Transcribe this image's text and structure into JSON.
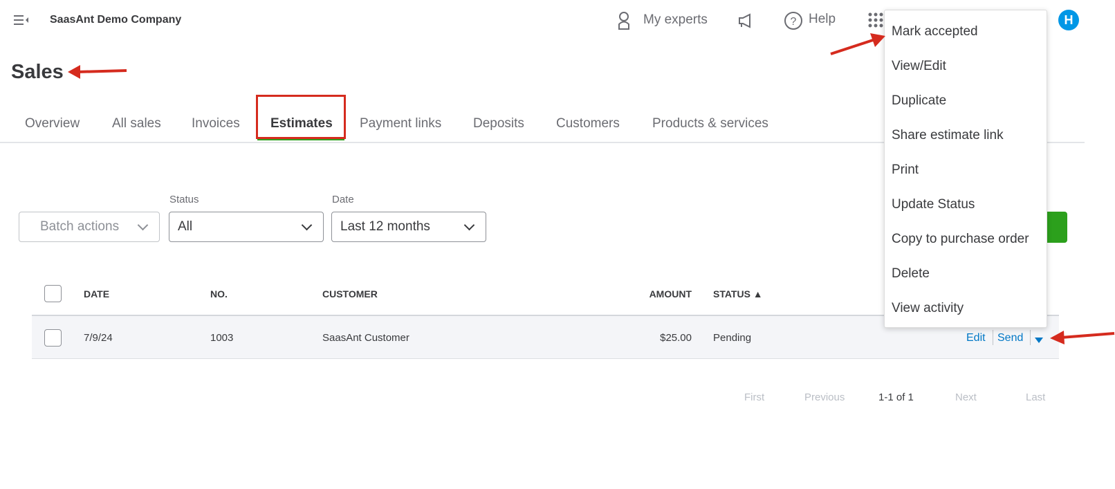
{
  "header": {
    "company": "SaasAnt Demo Company",
    "my_experts": "My experts",
    "help": "Help",
    "avatar_initial": "H",
    "avatar_color": "#0097e6"
  },
  "page": {
    "title": "Sales"
  },
  "tabs": [
    {
      "label": "Overview"
    },
    {
      "label": "All sales"
    },
    {
      "label": "Invoices"
    },
    {
      "label": "Estimates",
      "active": true
    },
    {
      "label": "Payment links"
    },
    {
      "label": "Deposits"
    },
    {
      "label": "Customers"
    },
    {
      "label": "Products & services"
    }
  ],
  "filters": {
    "batch_actions": "Batch actions",
    "status_label": "Status",
    "status_value": "All",
    "date_label": "Date",
    "date_value": "Last 12 months"
  },
  "table": {
    "headers": {
      "date": "DATE",
      "no": "NO.",
      "customer": "CUSTOMER",
      "amount": "AMOUNT",
      "status": "STATUS ▲"
    },
    "rows": [
      {
        "date": "7/9/24",
        "no": "1003",
        "customer": "SaasAnt Customer",
        "amount": "$25.00",
        "status": "Pending",
        "edit": "Edit",
        "send": "Send"
      }
    ]
  },
  "pagination": {
    "first": "First",
    "previous": "Previous",
    "range": "1-1 of 1",
    "next": "Next",
    "last": "Last"
  },
  "menu": {
    "items": [
      "Mark accepted",
      "View/Edit",
      "Duplicate",
      "Share estimate link",
      "Print",
      "Update Status",
      "Copy to purchase order",
      "Delete",
      "View activity"
    ]
  },
  "colors": {
    "accent_green": "#2ca01c",
    "link_blue": "#0077c5",
    "annotation_red": "#d52b1e"
  }
}
